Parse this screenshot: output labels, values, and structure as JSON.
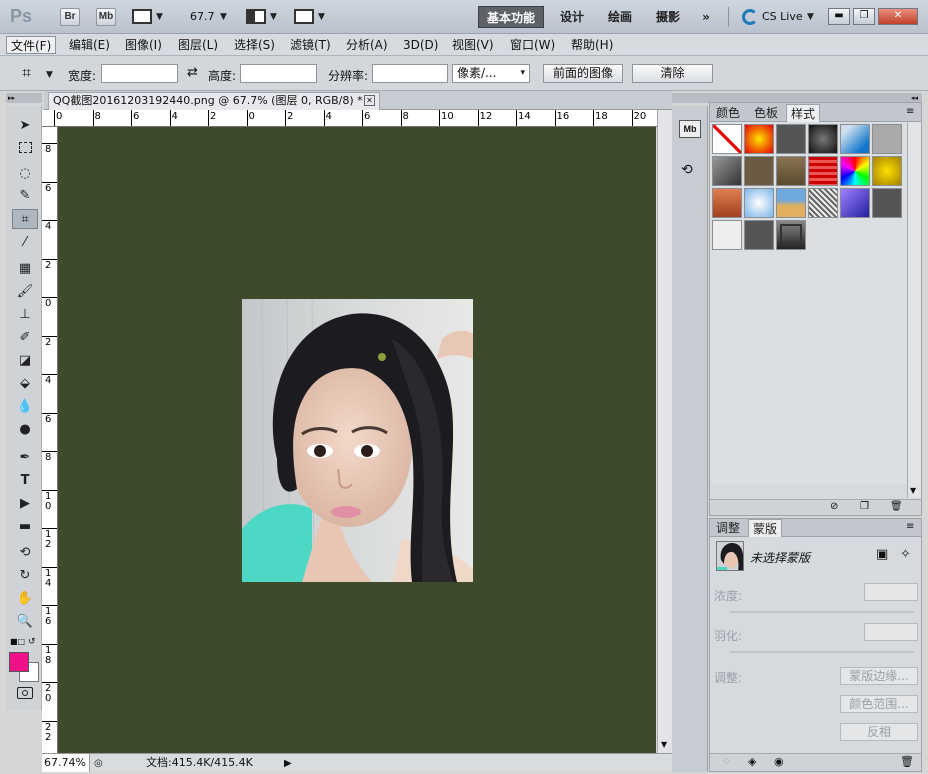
{
  "app": {
    "logo": "Ps",
    "bridge": "Br",
    "minibridge": "Mb",
    "zoom": "67.7",
    "workspaces": [
      "基本功能",
      "设计",
      "绘画",
      "摄影"
    ],
    "more": "»",
    "cslive": "CS Live"
  },
  "menu": [
    "文件(F)",
    "编辑(E)",
    "图像(I)",
    "图层(L)",
    "选择(S)",
    "滤镜(T)",
    "分析(A)",
    "3D(D)",
    "视图(V)",
    "窗口(W)",
    "帮助(H)"
  ],
  "options": {
    "width_label": "宽度:",
    "height_label": "高度:",
    "resolution_label": "分辨率:",
    "unit": "像素/...",
    "front_image": "前面的图像",
    "clear": "清除"
  },
  "document": {
    "tab_title": "QQ截图20161203192440.png @ 67.7% (图层 0, RGB/8) *",
    "close": "✕",
    "status_zoom": "67.74%",
    "status_doc": "文档:415.4K/415.4K"
  },
  "ruler": {
    "top": [
      "0",
      "8",
      "6",
      "4",
      "2",
      "0",
      "2",
      "4",
      "6",
      "8",
      "10",
      "12",
      "14",
      "16",
      "18",
      "20"
    ],
    "left": [
      "8",
      "6",
      "4",
      "2",
      "0",
      "2",
      "4",
      "6",
      "8",
      "10",
      "12",
      "14",
      "16",
      "18",
      "20",
      "22"
    ]
  },
  "panel1": {
    "tabs": [
      "颜色",
      "色板",
      "样式"
    ]
  },
  "panel2": {
    "tabs": [
      "调整",
      "蒙版"
    ],
    "no_mask": "未选择蒙版",
    "density": "浓度:",
    "feather": "羽化:",
    "adjust": "调整:",
    "mask_edge": "蒙版边缘...",
    "color_range": "颜色范围...",
    "invert": "反相"
  },
  "colors": {
    "foreground": "#f0108a",
    "background": "#ffffff",
    "canvas": "#3e4a2c"
  }
}
